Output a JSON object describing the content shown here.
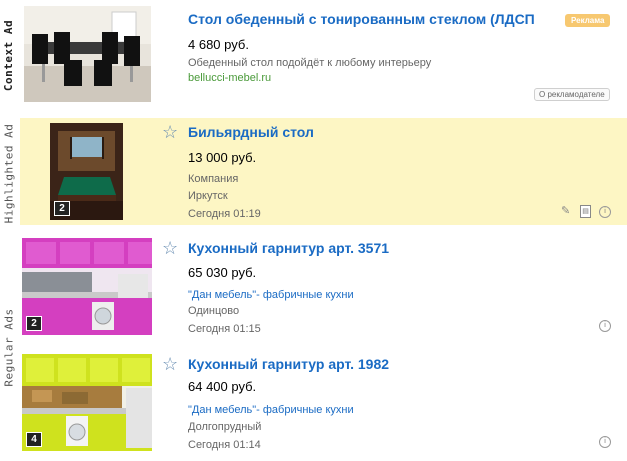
{
  "labels": {
    "context": "Context Ad",
    "highlighted": "Highlighted Ad",
    "regular": "Regular Ads"
  },
  "context_ad": {
    "title": "Стол обеденный с тонированным стеклом (ЛДСП",
    "badge": "Реклама",
    "price": "4 680 руб.",
    "description": "Обеденный стол подойдёт к любому интерьеру",
    "domain": "bellucci-mebel.ru",
    "advertiser_button": "О рекламодателе",
    "image_icon": "dining-table-photo"
  },
  "highlighted_ad": {
    "title": "Бильярдный стол",
    "price": "13 000 руб.",
    "seller_type": "Компания",
    "city": "Иркутск",
    "date": "Сегодня 01:19",
    "photo_count": "2",
    "background": "#fdf6c4",
    "icons": [
      "pin-icon",
      "document-icon",
      "info-icon"
    ]
  },
  "regular_ads": [
    {
      "title": "Кухонный гарнитур арт. 3571",
      "price": "65 030 руб.",
      "company": "\"Дан мебель\"- фабричные кухни",
      "city": "Одинцово",
      "date": "Сегодня 01:15",
      "photo_count": "2"
    },
    {
      "title": "Кухонный гарнитур арт. 1982",
      "price": "64 400 руб.",
      "company": "\"Дан мебель\"- фабричные кухни",
      "city": "Долгопрудный",
      "date": "Сегодня 01:14",
      "photo_count": "4"
    }
  ],
  "colors": {
    "link": "#1a6bc4",
    "highlight": "#fdf6c4",
    "badge": "#f7c870",
    "domain": "#4a9a3a"
  }
}
